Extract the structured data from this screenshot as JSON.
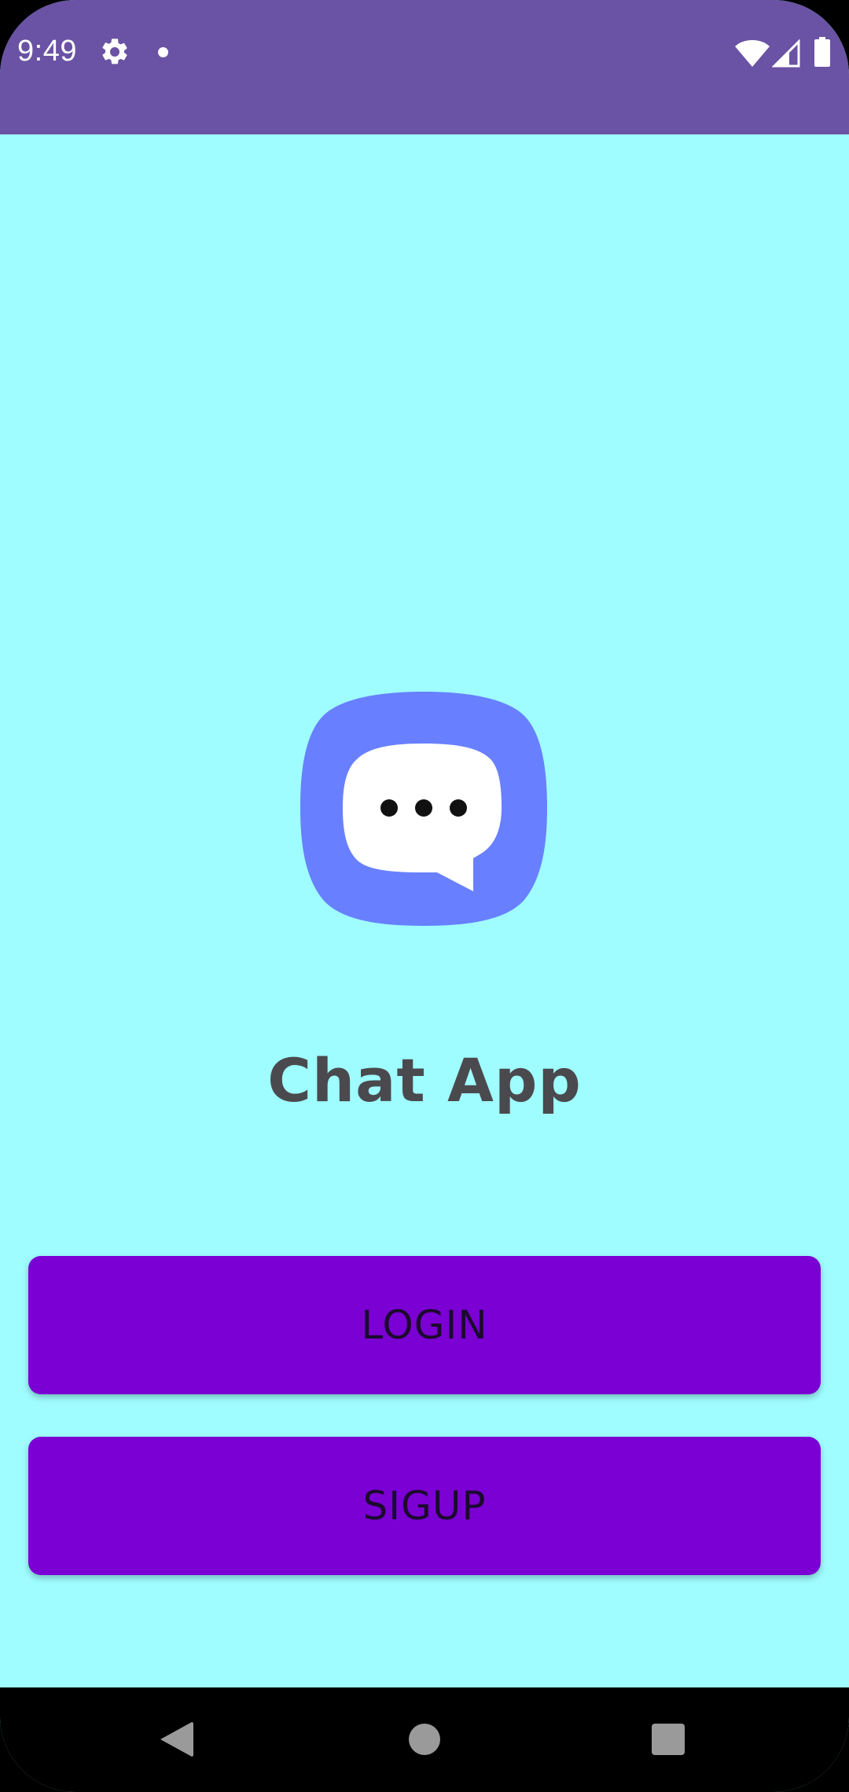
{
  "status_bar": {
    "time": "9:49",
    "icons": [
      "gear-icon",
      "notification-dot-icon",
      "wifi-icon",
      "signal-icon",
      "battery-icon"
    ],
    "background": "#6a52a4"
  },
  "main": {
    "background": "#9ffdff",
    "logo": "chat-bubble-icon",
    "title": "Chat App",
    "login_label": "LOGIN",
    "signup_label": "SIGUP",
    "button_color": "#7b00d3"
  },
  "nav_bar": {
    "icons": [
      "back-icon",
      "home-icon",
      "recents-icon"
    ]
  }
}
